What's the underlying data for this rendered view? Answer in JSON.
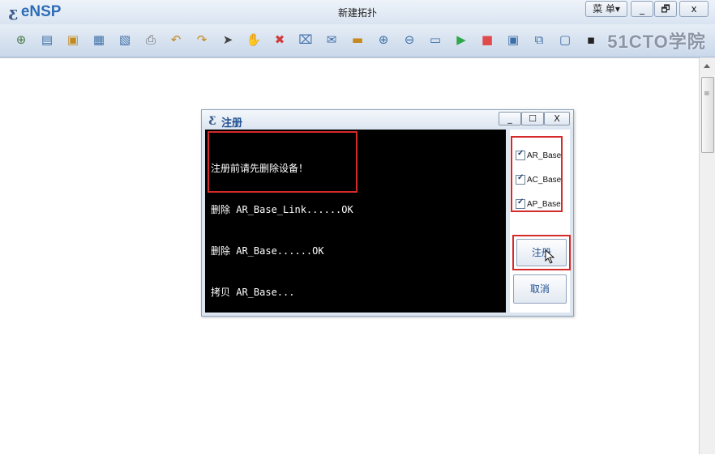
{
  "app": {
    "logo_text": "eNSP",
    "window_title": "新建拓扑",
    "menu_label": "菜 单▾"
  },
  "window_controls": {
    "minimize": "_",
    "restore": "🗗",
    "close": "x"
  },
  "toolbar": {
    "icons": [
      "new-topology-icon",
      "open-icon",
      "example-icon",
      "save-icon",
      "save-as-icon",
      "print-icon",
      "undo-icon",
      "redo-icon",
      "select-pointer-icon",
      "pan-hand-icon",
      "delete-icon",
      "delete-link-icon",
      "text-icon",
      "palette-icon",
      "zoom-in-icon",
      "zoom-out-icon",
      "fit-icon",
      "start-icon",
      "stop-icon",
      "capture-icon",
      "topology-icon",
      "panel-icon",
      "console-icon"
    ],
    "watermark": "51CTO学院"
  },
  "dialog": {
    "title": "注册",
    "controls": {
      "minimize": "_",
      "maximize": "☐",
      "close": "X"
    },
    "console_lines": [
      "注册前请先删除设备！",
      "删除 AR_Base_Link......OK",
      "删除 AR_Base......OK",
      "拷贝 AR_Base..."
    ],
    "checkboxes": [
      {
        "label": "AR_Base",
        "checked": true
      },
      {
        "label": "AC_Base",
        "checked": true
      },
      {
        "label": "AP_Base",
        "checked": true
      }
    ],
    "register_label": "注册",
    "cancel_label": "取消"
  }
}
